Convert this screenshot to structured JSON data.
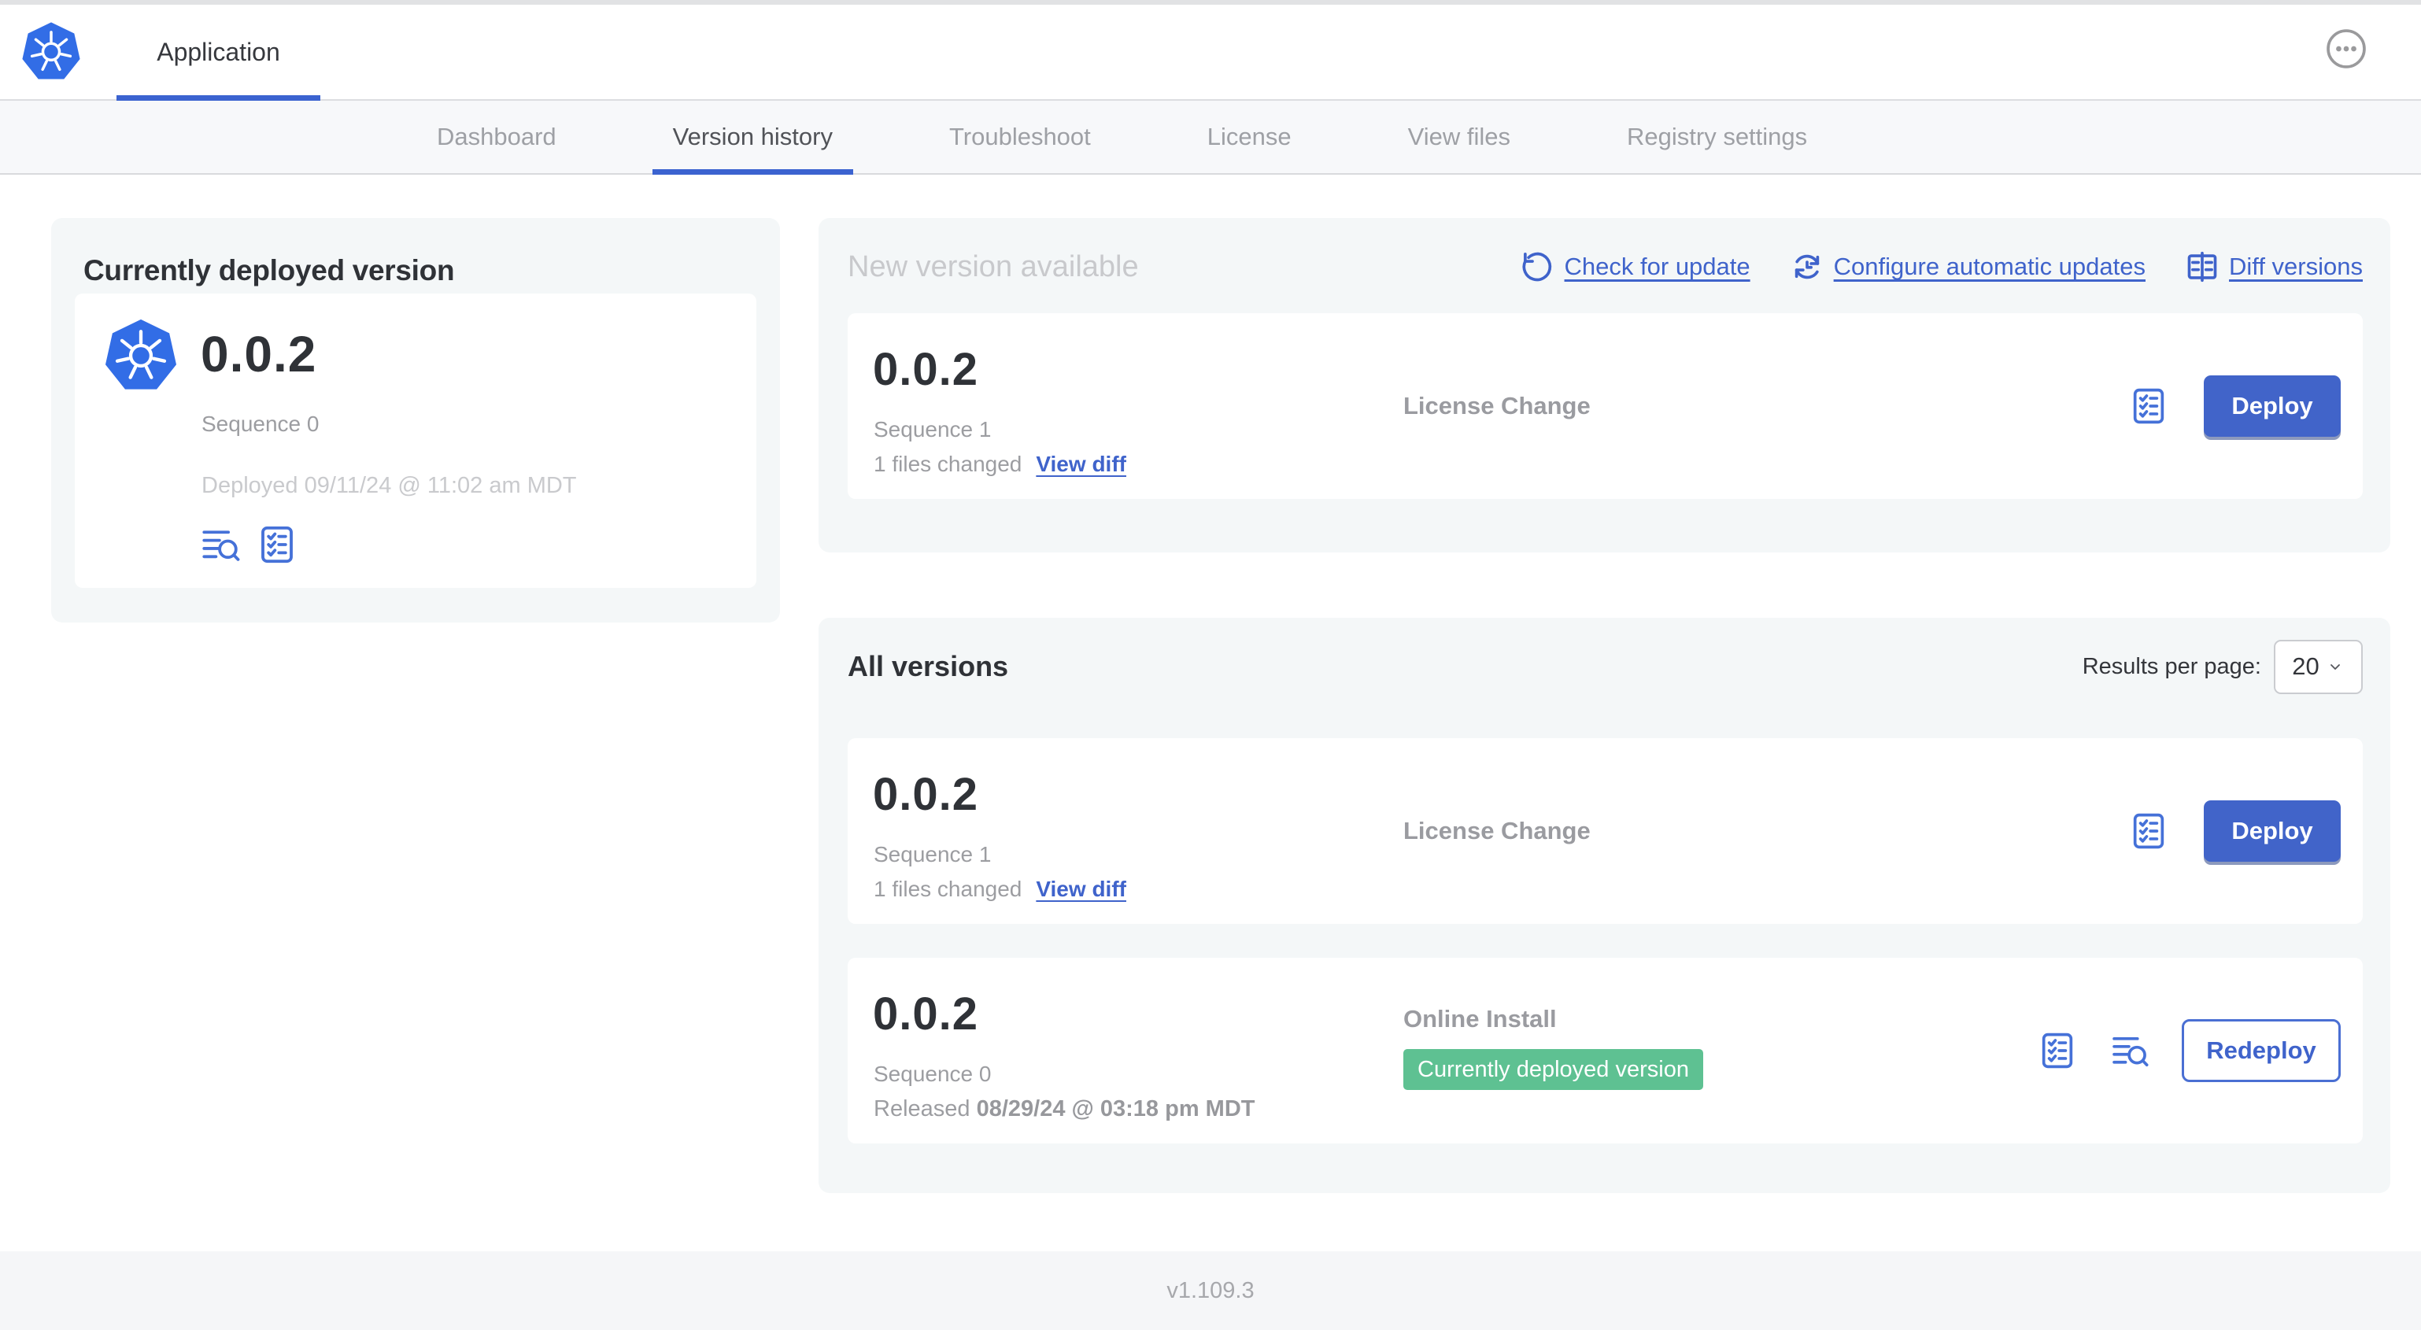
{
  "header": {
    "app_title": "Application"
  },
  "nav": {
    "tabs": [
      {
        "label": "Dashboard"
      },
      {
        "label": "Version history"
      },
      {
        "label": "Troubleshoot"
      },
      {
        "label": "License"
      },
      {
        "label": "View files"
      },
      {
        "label": "Registry settings"
      }
    ]
  },
  "current_deployed": {
    "title": "Currently deployed version",
    "version": "0.0.2",
    "sequence": "Sequence 0",
    "deployed_at": "Deployed 09/11/24 @ 11:02 am MDT"
  },
  "new_version": {
    "title": "New version available",
    "links": [
      {
        "label": "Check for update",
        "icon": "refresh-icon"
      },
      {
        "label": "Configure automatic updates",
        "icon": "auto-update-clock-icon"
      },
      {
        "label": "Diff versions",
        "icon": "diff-icon"
      }
    ],
    "card": {
      "version": "0.0.2",
      "sequence": "Sequence 1",
      "files_changed": "1 files changed",
      "view_diff_label": "View diff",
      "release_notes": "License Change",
      "deploy_label": "Deploy"
    }
  },
  "all_versions": {
    "title": "All versions",
    "results_per_page_label": "Results per page:",
    "results_per_page_value": "20",
    "rows": [
      {
        "version": "0.0.2",
        "sequence": "Sequence 1",
        "files_changed": "1 files changed",
        "view_diff_label": "View diff",
        "source": "License Change",
        "action_label": "Deploy"
      },
      {
        "version": "0.0.2",
        "sequence": "Sequence 0",
        "released_prefix": "Released ",
        "released_date": "08/29/24 @ 03:18 pm MDT",
        "source": "Online Install",
        "badge": "Currently deployed version",
        "action_label": "Redeploy"
      }
    ]
  },
  "footer": {
    "version": "v1.109.3"
  },
  "colors": {
    "k8s_blue": "#326de6",
    "link_blue": "#3f63cb",
    "button_blue": "#4164c9",
    "badge_green": "#5ec192",
    "active_underline_blue": "#3b63d0",
    "panel_bg": "#f4f7f8"
  }
}
